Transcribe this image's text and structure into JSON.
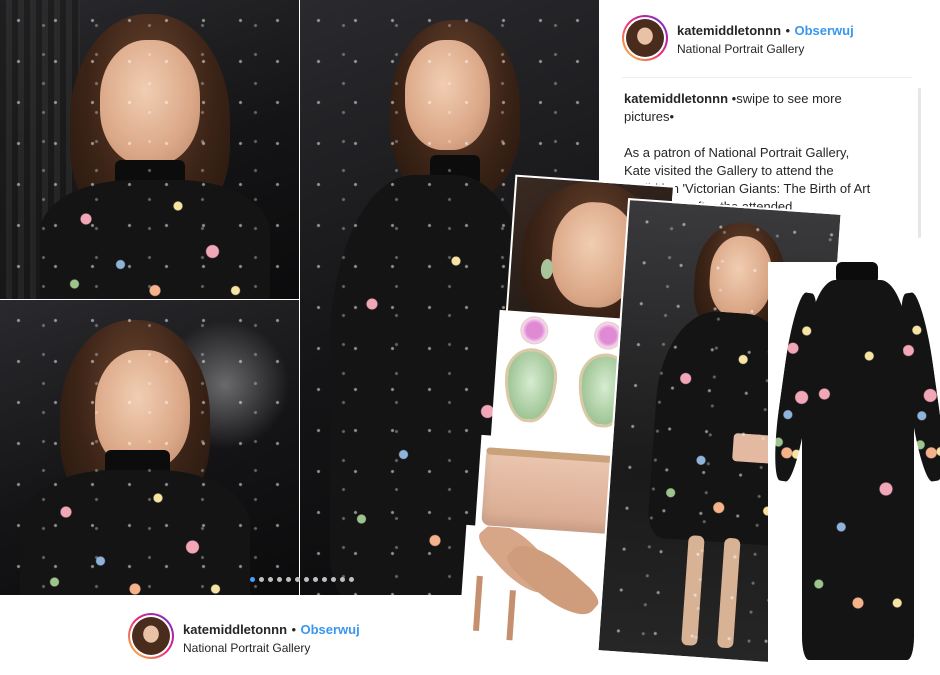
{
  "post_header_top": {
    "username": "katemiddletonnn",
    "separator": "•",
    "follow_label": "Obserwuj",
    "location": "National Portrait Gallery"
  },
  "caption": {
    "username": "katemiddletonnn",
    "lines": [
      "•swipe to see more",
      "pictures•",
      "",
      "As a patron of National Portrait Gallery,",
      "Kate visited the Gallery to attend the",
      "exhibition 'Victorian Giants: The Birth of Art",
      "...last night after the attended"
    ]
  },
  "post_header_bottom": {
    "username": "katemiddletonnn",
    "separator": "•",
    "follow_label": "Obserwuj",
    "location": "National Portrait Gallery"
  },
  "carousel": {
    "total": 12,
    "active_index": 0
  },
  "colors": {
    "follow_blue": "#3897f0",
    "dress_base": "#141414",
    "accent_pink": "#f2a7b8",
    "earring_green": "#b9d9b0",
    "clutch_nude": "#e3b9a2"
  }
}
